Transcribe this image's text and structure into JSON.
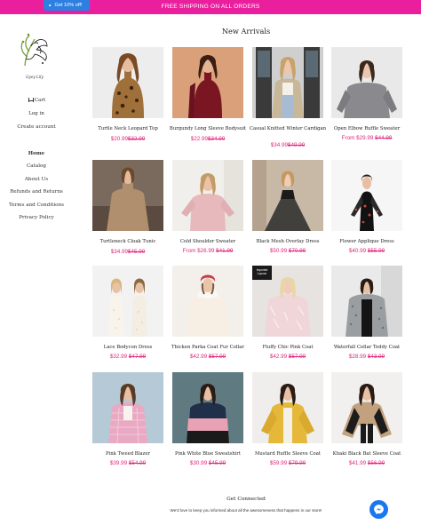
{
  "promo_bar": {
    "text": "FREE SHIPPING ON ALL ORDERS",
    "color": "#ea1f9d"
  },
  "discount_tab": {
    "text": "Get 10% off!",
    "icon": "chevron-up-icon",
    "color": "#2d7fe1"
  },
  "logo": {
    "text": "Gyey Lily"
  },
  "sidebar": {
    "account": [
      {
        "label": "Cart",
        "icon": "cart-icon"
      },
      {
        "label": "Log in"
      },
      {
        "label": "Create account"
      }
    ],
    "nav": [
      {
        "label": "Home",
        "active": true
      },
      {
        "label": "Catalog"
      },
      {
        "label": "About Us"
      },
      {
        "label": "Refunds and Returns"
      },
      {
        "label": "Terms and Conditions"
      },
      {
        "label": "Privacy Policy"
      }
    ]
  },
  "main": {
    "heading": "New Arrivals",
    "products": [
      {
        "name": "Turtle Neck Leopard Top",
        "prefix": "",
        "price": "$20.99",
        "old": "$32.99"
      },
      {
        "name": "Burgundy Long Sleeve Bodysuit",
        "prefix": "",
        "price": "$22.99",
        "old": "$34.99"
      },
      {
        "name": "Casual Knitted Winter Cardigan",
        "prefix": "",
        "price": "$34.99",
        "old": "$49.99"
      },
      {
        "name": "Open Elbow Ruffle Sweater",
        "prefix": "From",
        "price": "$29.99",
        "old": "$44.99"
      },
      {
        "name": "Turtleneck Cloak Tunic",
        "prefix": "",
        "price": "$34.99",
        "old": "$45.99"
      },
      {
        "name": "Cold Shoulder Sweater",
        "prefix": "From",
        "price": "$26.99",
        "old": "$41.99"
      },
      {
        "name": "Black Mesh Overlay Dress",
        "prefix": "",
        "price": "$50.99",
        "old": "$70.99"
      },
      {
        "name": "Flower Applique Dress",
        "prefix": "",
        "price": "$40.99",
        "old": "$55.99"
      },
      {
        "name": "Lace Bodycon Dress",
        "prefix": "",
        "price": "$32.99",
        "old": "$47.99"
      },
      {
        "name": "Thicken Parka Coat Fur Collar",
        "prefix": "",
        "price": "$42.99",
        "old": "$57.99"
      },
      {
        "name": "Fluffy Chic Pink Coat",
        "prefix": "",
        "price": "$42.99",
        "old": "$57.99"
      },
      {
        "name": "Waterfall Collar Teddy Coat",
        "prefix": "",
        "price": "$28.99",
        "old": "$43.99"
      },
      {
        "name": "Pink Tweed Blazer",
        "prefix": "",
        "price": "$39.99",
        "old": "$54.99"
      },
      {
        "name": "Pink White Blue Sweatshirt",
        "prefix": "",
        "price": "$30.99",
        "old": "$45.99"
      },
      {
        "name": "Mustard Ruffle Sleeve Coat",
        "prefix": "",
        "price": "$59.99",
        "old": "$79.99"
      },
      {
        "name": "Khaki Black Bat Sleeve Coat",
        "prefix": "",
        "price": "$41.99",
        "old": "$56.99"
      }
    ],
    "badge_text": "Imported Lopoon"
  },
  "footer": {
    "title": "Get Connected",
    "text": "We'd love to keep you informed about all the awesomeness that happens in our store!"
  },
  "messenger": {
    "icon": "messenger-icon",
    "color": "#1877f2"
  },
  "price_color": "#e0287e"
}
